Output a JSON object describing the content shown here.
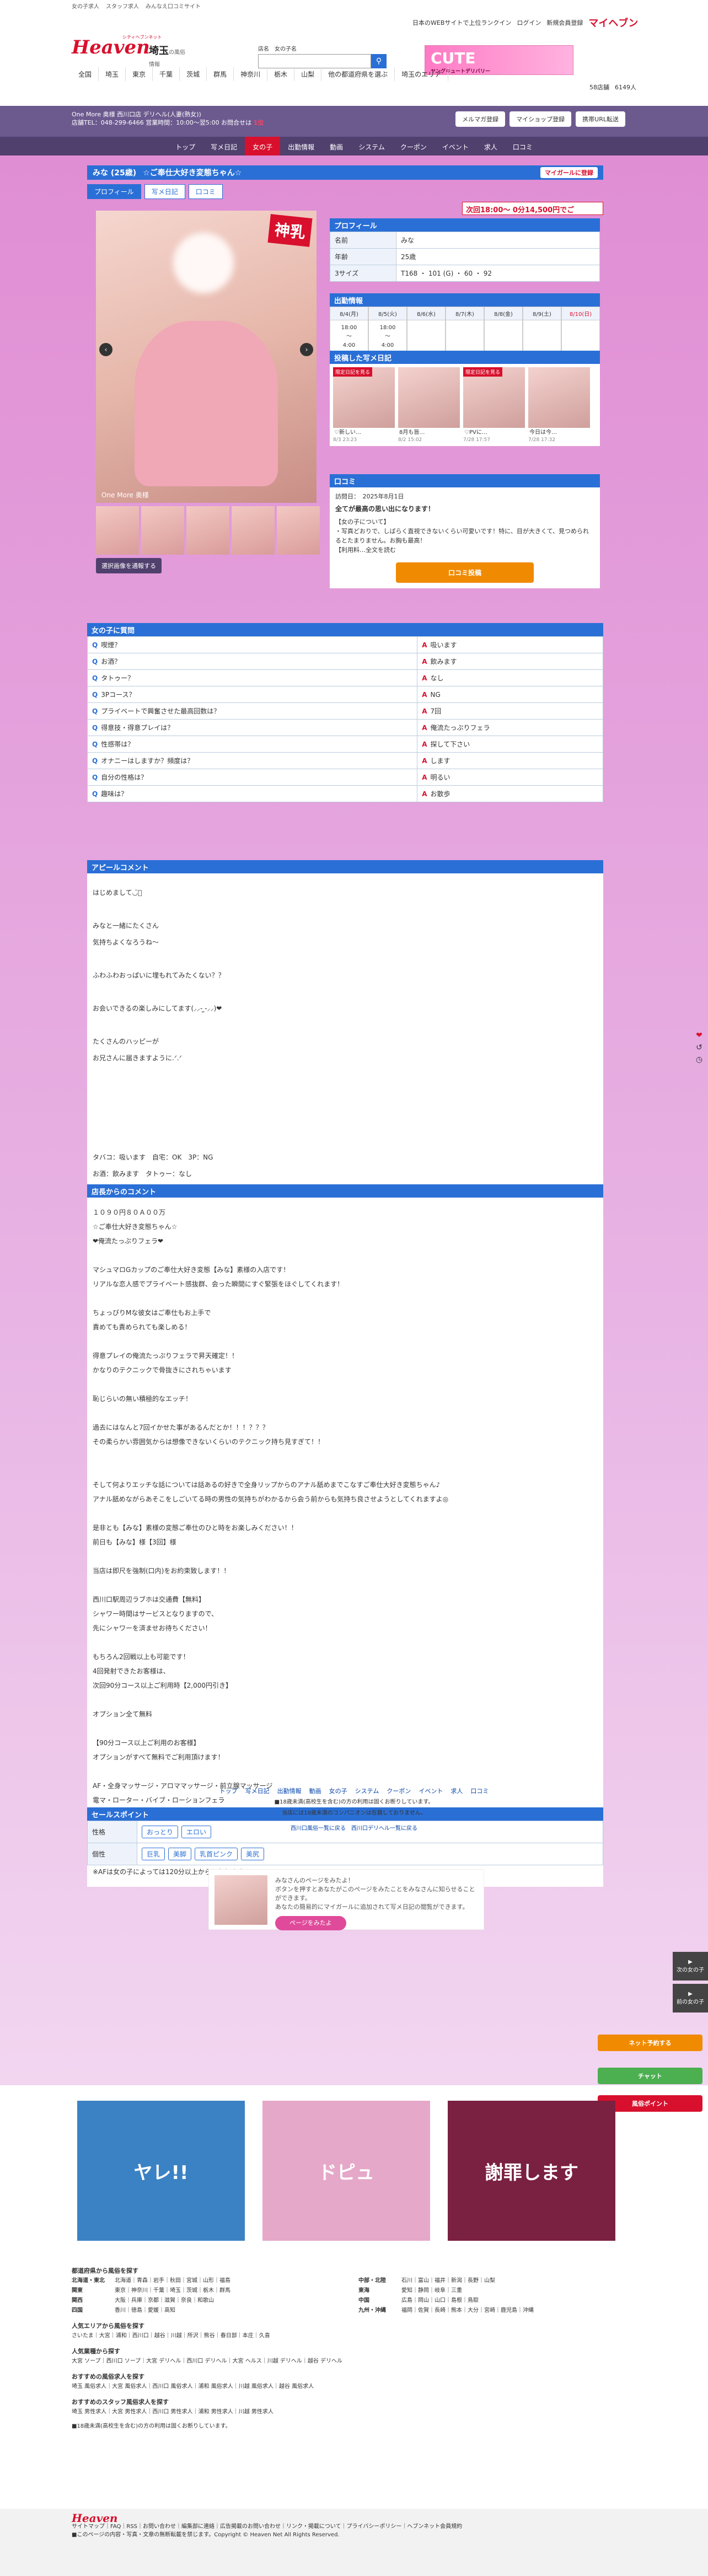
{
  "topbar": [
    "女の子求人",
    "スタッフ求人",
    "みんなえ口コミサイト"
  ],
  "logo": {
    "brand": "Heaven",
    "tagline": "シティヘブンネット",
    "area": "埼玉",
    "area_sub": "の風俗情報"
  },
  "search": {
    "label1": "店名",
    "label2": "女の子名",
    "placeholder": "",
    "icon": "search-icon"
  },
  "header_links": [
    "日本のWEBサイトで上位ランクイン",
    "ログイン",
    "新規会員登録"
  ],
  "mypage": "マイヘブン",
  "banner": {
    "title": "CUTE",
    "sub": "ヤングキュートデリバリー"
  },
  "nav": [
    "全国",
    "埼玉",
    "東京",
    "千葉",
    "茨城",
    "群馬",
    "神奈川",
    "栃木",
    "山梨",
    "他の都道府県を選ぶ",
    "埼玉のエリア"
  ],
  "counts": {
    "shops": "58店舗",
    "girls": "6149人"
  },
  "shop": {
    "name": "One More 奥様 西川口店 デリヘル(人妻(熟女))",
    "phone": "店舗TEL：048-299-6466 営業時間：10:00～翌5:00 お問合せは",
    "rank": "1位",
    "buttons": [
      "メルマガ登録",
      "マイショップ登録",
      "携帯URL転送"
    ]
  },
  "shopnav": [
    "トップ",
    "写メ日記",
    "女の子",
    "出勤情報",
    "動画",
    "システム",
    "クーポン",
    "イベント",
    "求人",
    "口コミ"
  ],
  "girl": {
    "name": "みな (25歳)",
    "catch": "☆ご奉仕大好き変態ちゃん☆",
    "mylist": "マイガールに登録",
    "tabs": [
      "プロフィール",
      "写メ日記",
      "口コミ"
    ],
    "badge": "神乳",
    "caption": "One More 奥様",
    "set_button": "選択画像を通報する"
  },
  "profile": {
    "head": "プロフィール",
    "rows": [
      {
        "k": "名前",
        "v": "みな"
      },
      {
        "k": "年齢",
        "v": "25歳"
      },
      {
        "k": "3サイズ",
        "v": "T168 ・ 101 (G) ・ 60 ・ 92"
      }
    ],
    "banner": "次回18:00～ 0分14,500円でご"
  },
  "schedule": {
    "head": "出勤情報",
    "days": [
      {
        "d": "8/4(月)",
        "t": "18:00\n～\n4:00"
      },
      {
        "d": "8/5(火)",
        "t": "18:00\n～\n4:00"
      },
      {
        "d": "8/6(水)",
        "t": ""
      },
      {
        "d": "8/7(木)",
        "t": ""
      },
      {
        "d": "8/8(金)",
        "t": ""
      },
      {
        "d": "8/9(土)",
        "t": ""
      },
      {
        "d": "8/10(日)",
        "t": ""
      }
    ]
  },
  "diary": {
    "head": "投稿した写メ日記",
    "items": [
      {
        "tx": "♡新しい…",
        "tm": "8/3 23:23"
      },
      {
        "tx": "8月も皆…",
        "tm": "8/2 15:02"
      },
      {
        "tx": "♡PVに…",
        "tm": "7/28 17:57"
      },
      {
        "tx": "今日は今…",
        "tm": "7/28 17:32"
      }
    ],
    "label": "限定日記を見る"
  },
  "review": {
    "head": "口コミ",
    "date": "訪問日：　2025年8月1日",
    "title": "全てが最高の思い出になります！",
    "body": "【女の子について】\n・写真どおりで、しばらく直視できないくらい可愛いです！特に、目が大きくて、見つめられるとたまりません。お胸も最高！\n【利用料…全文を読む",
    "post": "口コミ投稿"
  },
  "qa": {
    "head": "女の子に質問",
    "rows": [
      {
        "q": "喫煙？",
        "a": "吸います"
      },
      {
        "q": "お酒？",
        "a": "飲みます"
      },
      {
        "q": "タトゥー？",
        "a": "なし"
      },
      {
        "q": "3Pコース？",
        "a": "NG"
      },
      {
        "q": "プライベートで興奮させた最高回数は？",
        "a": "7回"
      },
      {
        "q": "得意技・得意プレイは？",
        "a": "俺流たっぷりフェラ"
      },
      {
        "q": "性感帯は？",
        "a": "探して下さい"
      },
      {
        "q": "オナニーはしますか？頻度は？",
        "a": "します"
      },
      {
        "q": "自分の性格は？",
        "a": "明るい"
      },
      {
        "q": "趣味は？",
        "a": "お散歩"
      }
    ]
  },
  "appeal": {
    "head": "アピールコメント",
    "text": "はじめまして◡̈⃝\n\nみなと一緒にたくさん\n気持ちよくなろうね〜\n\nふわふわおっぱいに埋もれてみたくない？？\n\nお会いできるの楽しみにしてます(⸝⸝- ̫-⸝⸝)❤︎\n\nたくさんのハッピーが\nお兄さんに届きますように.ᐟ.ᐟ\n\n\n\n\n\nタバコ：吸います　自宅：OK　3P：NG\nお酒：飲みます　タトゥー：なし\n\n★みな素様の対応オプション（90分コースからすべて無料でつけ放題!!）\n全身マッサージ・アロママッサージ・前立腺マッサージ・電マ・ローター・バイブ・ローションフェラ・即クンニ・聖水・イラマチオ・ごっくん・パイズリ・アナル舐め・オナニー鑑賞・顔射"
  },
  "shopcomment": {
    "head": "店長からのコメント",
    "text": "１０９０円８０Ａ００万\n☆ご奉仕大好き変態ちゃん☆\n❤︎俺流たっぷりフェラ❤︎\n\nマシュマロGカップのご奉仕大好き変態【みな】素様の入店です！\nリアルな恋人感でプライベート感抜群、会った瞬間にすぐ緊張をほぐしてくれます！\n\nちょっぴりMな彼女はご奉仕もお上手で\n責めても責められても楽しめる！\n\n得意プレイの俺流たっぷりフェラで昇天確定！！\nかなりのテクニックで骨抜きにされちゃいます\n\n恥じらいの無い積極的なエッチ！\n\n過去にはなんと7回イかせた事があるんだとか！！！？？？\nその柔らかい雰囲気からは想像できないくらいのテクニック持ち見すぎて！！\n\n\nそして何よりエッチな話については話あるの好きで全身リップからのアナル舐めまでこなすご奉仕大好き変態ちゃん♪\nアナル舐めながらあそこをしごいてる時の男性の気持ちがわかるから会う前からも気持ち良させようとしてくれますよ◎\n\n是非とも【みな】素様の変態ご奉仕のひと時をお楽しみください！！\n前日も【みな】様【3回】様\n\n当店は即尺を強制(口内)をお約束致します！！\n\n西川口駅周辺ラブホは交通費【無料】\nシャワー時間はサービスとなりますので、\n先にシャワーを済ませお待ちください！\n\nもちろん2回戦以上も可能です！\n4回発射できたお客様は、\n次回90分コース以上ご利用時【2,000円引き】\n\nオプション全て無料\n\n【90分コース以上ご利用のお客様】\nオプションがすべて無料でご利用頂けます！\n\nAF・全身マッサージ・アロママッサージ・前立腺マッサージ\n電マ・ローター・バイブ・ローションフェラ\n即クンニ・真即尺・聖水・放尿・イラマチオ\nごっくん・パイズリ・アナル舐め・オナニー鑑賞\n顔射・写真撮影・動画撮影\n\n※AFは女の子によっては120分以上からとなります。"
  },
  "points": {
    "head": "セールスポイント",
    "rows": [
      {
        "k": "性格",
        "tags": [
          "おっとり",
          "エロい"
        ]
      },
      {
        "k": "個性",
        "tags": [
          "巨乳",
          "美脚",
          "乳首ピンク",
          "美尻"
        ]
      }
    ]
  },
  "visit": {
    "text": "みなさんのページをみたよ！\nボタンを押すとあなたがこのページをみたことをみなさんに知らせることができます。\nあなたの簡易的にマイガールに追加されて写メ日記の閲覧ができます。",
    "button": "ページをみたよ"
  },
  "footnav": {
    "links": [
      "トップ",
      "写メ日記",
      "出勤情報",
      "動画",
      "女の子",
      "システム",
      "クーポン",
      "イベント",
      "求人",
      "口コミ"
    ],
    "note1": "■18歳未満(高校生を含む)の方の利用は固くお断りしています。",
    "note2": "当店には18歳未満のコンパニオンは在籍しておりません。",
    "note3": "西川口風俗一覧に戻る　西川口デリヘル一覧に戻る"
  },
  "side": [
    "次の女の子",
    "前の女の子"
  ],
  "floats": [
    {
      "label": "ネット予約する",
      "color": "#f08a00"
    },
    {
      "label": "チャット",
      "color": "#4caf50"
    },
    {
      "label": "風俗ポイント",
      "color": "#d8102d"
    }
  ],
  "bottom_banners": [
    {
      "text": "ヤレ!!",
      "color": "#3b82c4"
    },
    {
      "text": "ドピュ",
      "color": "#e5a8c8"
    },
    {
      "text": "謝罪します",
      "color": "#7a2040"
    }
  ],
  "links": {
    "area_head": "都道府県から風俗を探す",
    "areas": [
      {
        "k": "北海道・東北",
        "v": "北海道｜青森｜岩手｜秋田｜宮城｜山形｜福島"
      },
      {
        "k": "関東",
        "v": "東京｜神奈川｜千葉｜埼玉｜茨城｜栃木｜群馬"
      },
      {
        "k": "関西",
        "v": "大阪｜兵庫｜京都｜滋賀｜奈良｜和歌山"
      },
      {
        "k": "四国",
        "v": "香川｜徳島｜愛媛｜高知"
      }
    ],
    "areas2": [
      {
        "k": "中部・北陸",
        "v": "石川｜富山｜福井｜新潟｜長野｜山梨"
      },
      {
        "k": "東海",
        "v": "愛知｜静岡｜岐阜｜三重"
      },
      {
        "k": "中国",
        "v": "広島｜岡山｜山口｜島根｜鳥取"
      },
      {
        "k": "九州・沖縄",
        "v": "福岡｜佐賀｜長崎｜熊本｜大分｜宮崎｜鹿児島｜沖縄"
      }
    ],
    "pop_head": "人気エリアから風俗を探す",
    "pop": "さいたま｜大宮｜浦和｜西川口｜越谷｜川越｜所沢｜熊谷｜春日部｜本庄｜久喜",
    "type_head": "人気業種から探す",
    "types": "大宮 ソープ｜西川口 ソープ｜大宮 デリヘル｜西川口 デリヘル｜大宮 ヘルス｜川越 デリヘル｜越谷 デリヘル",
    "girl_head": "おすすめの風俗求人を探す",
    "girls": "埼玉 風俗求人｜大宮 風俗求人｜西川口 風俗求人｜浦和 風俗求人｜川越 風俗求人｜越谷 風俗求人",
    "staff_head": "おすすめのスタッフ風俗求人を探す",
    "staff": "埼玉 男性求人｜大宮 男性求人｜西川口 男性求人｜浦和 男性求人｜川越 男性求人",
    "note": "■18歳未満(高校生を含む)の方の利用は固くお断りしています。"
  },
  "footer": {
    "logo": "Heaven",
    "links": "サイトマップ｜FAQ｜RSS｜お問い合わせ｜編集部に連絡｜広告掲載のお問い合わせ｜リンク・掲載について｜プライバシーポリシー｜ヘブンネット会員規約",
    "copy": "■このページの内容・写真・文章の無断転載を禁じます。Copyright © Heaven Net All Rights Reserved."
  }
}
